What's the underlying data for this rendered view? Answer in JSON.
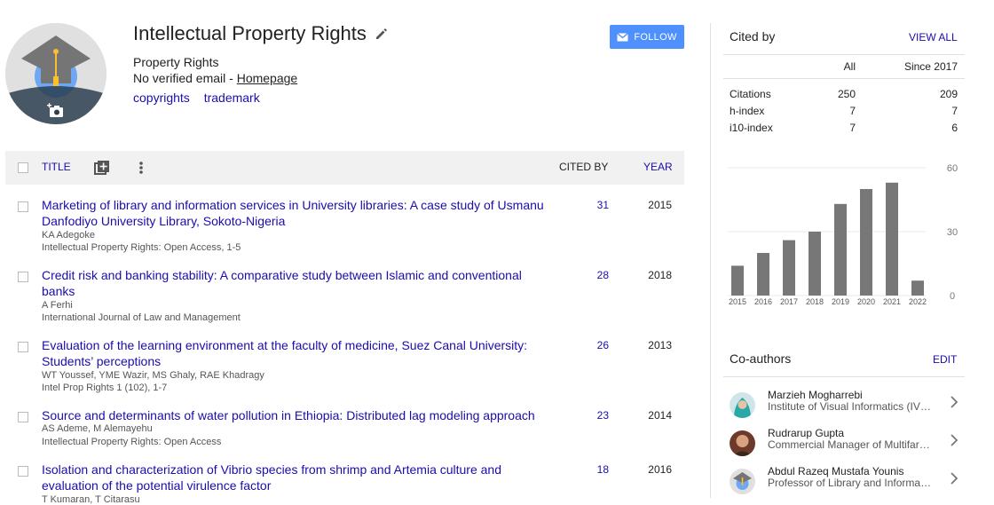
{
  "profile": {
    "name": "Intellectual Property Rights",
    "affiliation": "Property Rights",
    "email_prefix": "No verified email - ",
    "homepage_label": "Homepage",
    "interests": [
      "copyrights",
      "trademark"
    ],
    "follow_label": "FOLLOW"
  },
  "table": {
    "title_header": "TITLE",
    "cited_header": "CITED BY",
    "year_header": "YEAR",
    "rows": [
      {
        "title": "Marketing of library and information services in University libraries: A case study of Usmanu Danfodiyo University Library, Sokoto-Nigeria",
        "authors": "KA Adegoke",
        "venue": "Intellectual Property Rights: Open Access, 1-5",
        "cites": "31",
        "year": "2015"
      },
      {
        "title": "Credit risk and banking stability: A comparative study between Islamic and conventional banks",
        "authors": "A Ferhi",
        "venue": "International Journal of Law and Management",
        "cites": "28",
        "year": "2018"
      },
      {
        "title": "Evaluation of the learning environment at the faculty of medicine, Suez Canal University: Students’ perceptions",
        "authors": "WT Youssef, YME Wazir, MS Ghaly, RAE Khadragy",
        "venue": "Intel Prop Rights 1 (102), 1-7",
        "cites": "26",
        "year": "2013"
      },
      {
        "title": "Source and determinants of water pollution in Ethiopia: Distributed lag modeling approach",
        "authors": "AS Ademe, M Alemayehu",
        "venue": "Intellectual Property Rights: Open Access",
        "cites": "23",
        "year": "2014"
      },
      {
        "title": "Isolation and characterization of Vibrio species from shrimp and Artemia culture and evaluation of the potential virulence factor",
        "authors": "T Kumaran, T Citarasu",
        "venue": "",
        "cites": "18",
        "year": "2016"
      }
    ]
  },
  "cited_by": {
    "title": "Cited by",
    "view_all": "VIEW ALL",
    "col_all": "All",
    "col_since": "Since 2017",
    "rows": [
      {
        "label": "Citations",
        "all": "250",
        "since": "209"
      },
      {
        "label": "h-index",
        "all": "7",
        "since": "7"
      },
      {
        "label": "i10-index",
        "all": "7",
        "since": "6"
      }
    ]
  },
  "chart_data": {
    "type": "bar",
    "categories": [
      "2015",
      "2016",
      "2017",
      "2018",
      "2019",
      "2020",
      "2021",
      "2022"
    ],
    "values": [
      14,
      20,
      26,
      30,
      43,
      50,
      53,
      7
    ],
    "ylim": [
      0,
      60
    ],
    "yticks": [
      "60",
      "30",
      "0"
    ],
    "bar_color": "#777777"
  },
  "coauthors": {
    "title": "Co-authors",
    "edit_label": "EDIT",
    "items": [
      {
        "name": "Marzieh Mogharrebi",
        "desc": "Institute of Visual Informatics (IVI), Universiti Kebangsaan Malaysia"
      },
      {
        "name": "Rudrarup Gupta",
        "desc": "Commercial Manager of Multifarious projects"
      },
      {
        "name": "Abdul Razeq Mustafa Younis",
        "desc": "Professor of Library and Information Science"
      }
    ]
  },
  "colors": {
    "link": "#1a0dab",
    "follow_bg": "#4d90fe",
    "header_bg": "#f1f1f1"
  }
}
